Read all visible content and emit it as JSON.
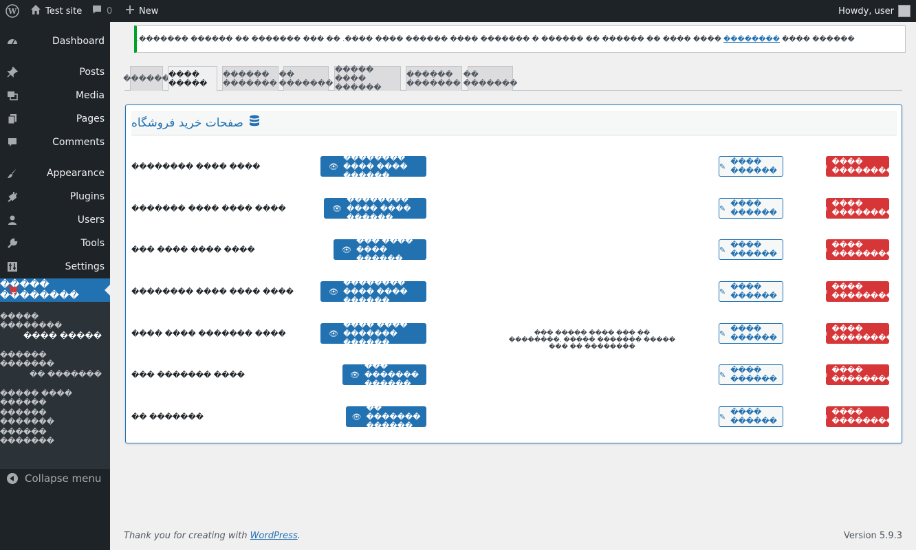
{
  "admin_bar": {
    "site_title": "Test site",
    "comments_count": "0",
    "new_label": "New",
    "howdy": "Howdy, user"
  },
  "sidebar": {
    "items": [
      {
        "name": "dashboard",
        "label": "Dashboard",
        "icon": "dashboard-icon"
      },
      {
        "name": "posts",
        "label": "Posts",
        "icon": "pushpin-icon"
      },
      {
        "name": "media",
        "label": "Media",
        "icon": "media-icon"
      },
      {
        "name": "pages",
        "label": "Pages",
        "icon": "pages-icon"
      },
      {
        "name": "comments",
        "label": "Comments",
        "icon": "comment-icon"
      },
      {
        "name": "appearance",
        "label": "Appearance",
        "icon": "brush-icon"
      },
      {
        "name": "plugins",
        "label": "Plugins",
        "icon": "plugin-icon"
      },
      {
        "name": "users",
        "label": "Users",
        "icon": "user-icon"
      },
      {
        "name": "tools",
        "label": "Tools",
        "icon": "wrench-icon"
      },
      {
        "name": "settings",
        "label": "Settings",
        "icon": "settings-icon"
      },
      {
        "name": "shop-plugin",
        "label": "����� ��������",
        "icon": "cart-icon"
      }
    ],
    "submenu": [
      "����� ��������",
      "���� �����",
      "������ �������",
      "�� �������",
      "����� ���� ������",
      "������ �������",
      "������ �������"
    ],
    "collapse_label": "Collapse menu"
  },
  "notice": {
    "text_before": "������ ���� ",
    "link": "��������",
    "text_after": " ���� ���� �� ������ �� ������ � ������� ���� ������ ���� ����. �� ��� ������� �� ������ �������."
  },
  "tabs": [
    "������",
    "���� �����",
    "������ �������",
    "�� �������",
    "����� ���� ������",
    "������ �������",
    "�� �������"
  ],
  "card": {
    "title": "صفحات خرید فروشگاه",
    "rows": [
      {
        "label": "�������� ���� ����",
        "view": "�������� ���� ���� ������",
        "note": "",
        "edit": "���� ������",
        "hide": "���� ��������"
      },
      {
        "label": "������� ���� ���� ����",
        "view": "�������� ���� ���� ������",
        "note": "",
        "edit": "���� ������",
        "hide": "���� ��������"
      },
      {
        "label": "��� ���� ���� ����",
        "view": "��� ���� ���� ������",
        "note": "",
        "edit": "���� ������",
        "hide": "���� ��������"
      },
      {
        "label": "�������� ���� ���� ����",
        "view": "�������� ���� ���� ������",
        "note": "",
        "edit": "���� ������",
        "hide": "���� ��������"
      },
      {
        "label": "���� ���� ������� ����",
        "view": "���� ���� ������� ������",
        "note": "��� ����� ���� ��� �� ��������. ����� ������� ����� ��� �� ��������",
        "edit": "���� ������",
        "hide": "���� ��������"
      },
      {
        "label": "��� ������� ����",
        "view": "��� ������� ������",
        "note": "",
        "edit": "���� ������",
        "hide": "���� ��������"
      },
      {
        "label": "�� �������",
        "view": "�� ������� ������",
        "note": "",
        "edit": "���� ������",
        "hide": "���� ��������"
      }
    ]
  },
  "footer": {
    "thanks_before": "Thank you for creating with ",
    "thanks_link": "WordPress",
    "thanks_after": ".",
    "version": "Version 5.9.3"
  },
  "colors": {
    "accent": "#2271b1",
    "danger": "#d63638",
    "success": "#00a32a",
    "dark": "#1d2327"
  }
}
